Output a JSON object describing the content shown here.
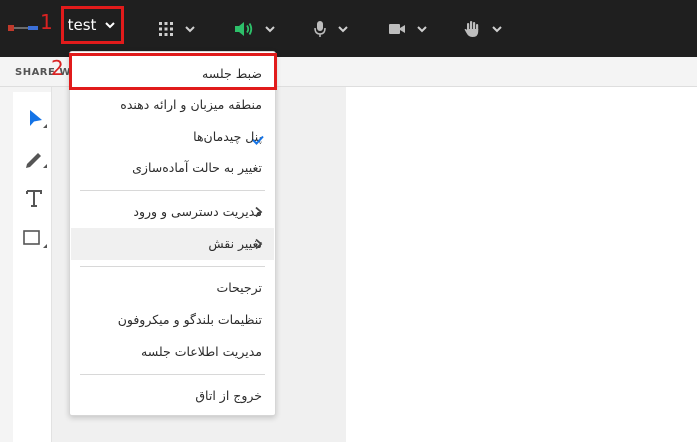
{
  "annotations": {
    "step1": "1",
    "step2": "2"
  },
  "topbar": {
    "logo": "app-logo",
    "room_button_label": "test",
    "icons": [
      "apps-grid-icon",
      "speaker-icon",
      "microphone-icon",
      "camera-icon",
      "raise-hand-icon"
    ]
  },
  "subbar": {
    "share_label": "SHARE W"
  },
  "tools": [
    "select-arrow-icon",
    "pencil-icon",
    "text-tool-icon",
    "rectangle-tool-icon"
  ],
  "menu": {
    "items": [
      {
        "label": "ضبط جلسه"
      },
      {
        "label": "منطقه میزبان و ارائه دهنده"
      },
      {
        "label": "پنل چیدمان‌ها",
        "checked": true
      },
      {
        "label": "تغییر به حالت آماده‌سازی"
      },
      {
        "label": "مدیریت دسترسی و ورود",
        "submenu": true
      },
      {
        "label": "تغییر نقش",
        "submenu": true,
        "highlighted": true
      },
      {
        "label": "ترجیحات"
      },
      {
        "label": "تنظیمات بلندگو و میکروفون"
      },
      {
        "label": "مدیریت اطلاعات جلسه"
      },
      {
        "label": "خروج از اتاق"
      }
    ]
  },
  "colors": {
    "topbar_bg": "#1f1f1f",
    "annotation_red": "#e11b1b",
    "speaker_green": "#2dc06a",
    "accent_blue": "#1473e6"
  }
}
